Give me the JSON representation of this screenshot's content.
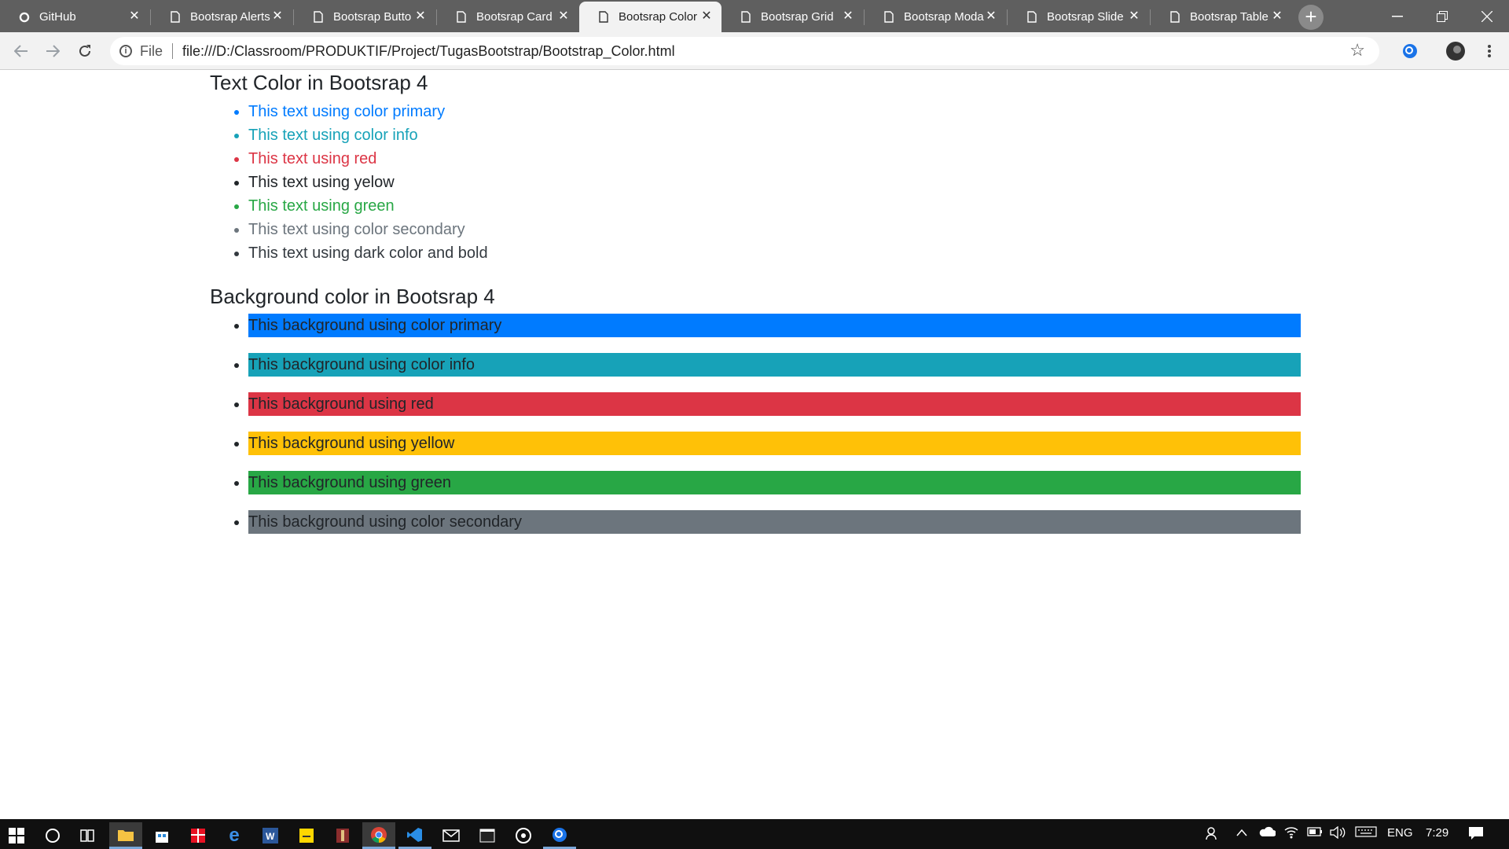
{
  "browser": {
    "tabs": [
      {
        "title": "GitHub",
        "icon": "github-icon"
      },
      {
        "title": "Bootsrap Alerts",
        "icon": "page-icon"
      },
      {
        "title": "Bootsrap Butto",
        "icon": "page-icon"
      },
      {
        "title": "Bootsrap Card",
        "icon": "page-icon"
      },
      {
        "title": "Bootsrap Color",
        "icon": "page-icon",
        "active": true
      },
      {
        "title": "Bootsrap Grid",
        "icon": "page-icon"
      },
      {
        "title": "Bootsrap Moda",
        "icon": "page-icon"
      },
      {
        "title": "Bootsrap Slide",
        "icon": "page-icon"
      },
      {
        "title": "Bootsrap Table",
        "icon": "page-icon"
      }
    ],
    "address": {
      "scheme_label": "File",
      "url": "file:///D:/Classroom/PRODUKTIF/Project/TugasBootstrap/Bootstrap_Color.html"
    }
  },
  "page": {
    "text_section": {
      "heading": "Text Color in Bootsrap 4",
      "items": [
        {
          "text": "This text using color primary",
          "color": "#007bff"
        },
        {
          "text": "This text using color info",
          "color": "#17a2b8"
        },
        {
          "text": "This text using red",
          "color": "#dc3545"
        },
        {
          "text": "This text using yelow",
          "color": "#212529"
        },
        {
          "text": "This text using green",
          "color": "#28a745"
        },
        {
          "text": "This text using color secondary",
          "color": "#6c757d"
        },
        {
          "text": "This text using dark color and bold",
          "color": "#343a40"
        }
      ]
    },
    "bg_section": {
      "heading": "Background color in Bootsrap 4",
      "items": [
        {
          "text": "This background using color primary",
          "color": "#007bff"
        },
        {
          "text": "This background using color info",
          "color": "#17a2b8"
        },
        {
          "text": "This background using red",
          "color": "#dc3545"
        },
        {
          "text": "This background using yellow",
          "color": "#ffc107"
        },
        {
          "text": "This background using green",
          "color": "#28a745"
        },
        {
          "text": "This background using color secondary",
          "color": "#6c757d"
        }
      ]
    }
  },
  "taskbar": {
    "language": "ENG",
    "time": "7:29"
  }
}
